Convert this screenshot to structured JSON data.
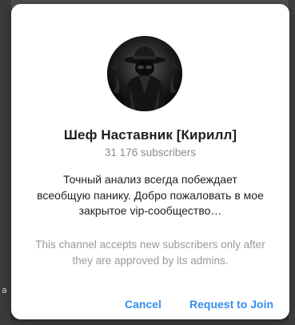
{
  "dialog": {
    "title": "Шеф Наставник [Кирилл]",
    "subscribers": "31 176 subscribers",
    "description": "Точный анализ всегда побеждает всеобщую панику. Добро пожаловать в мое закрытое vip-сообщество…",
    "approval_note": "This channel accepts new subscribers only after they are approved by its admins.",
    "avatar_icon": "hooded-figure-avatar",
    "cancel_label": "Cancel",
    "join_label": "Request to Join"
  },
  "colors": {
    "accent": "#3390ec",
    "title": "#1f1f1f",
    "muted": "#8c8c8c",
    "dialog_bg": "#ffffff"
  }
}
